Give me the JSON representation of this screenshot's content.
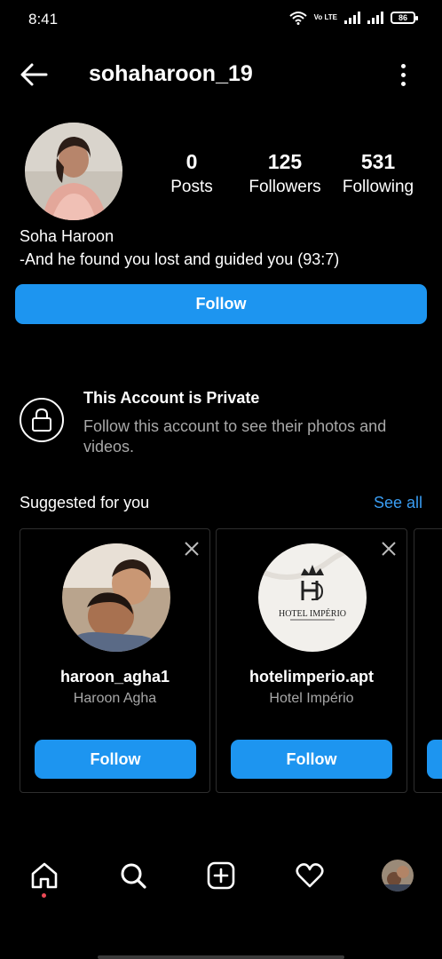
{
  "status_bar": {
    "time": "8:41",
    "volte": "Vo LTE",
    "battery": "86"
  },
  "header": {
    "username": "sohaharoon_19"
  },
  "profile": {
    "stats": [
      {
        "value": "0",
        "label": "Posts"
      },
      {
        "value": "125",
        "label": "Followers"
      },
      {
        "value": "531",
        "label": "Following"
      }
    ],
    "full_name": "Soha Haroon",
    "bio": "-And he found you lost and guided you (93:7)",
    "follow_label": "Follow"
  },
  "private_notice": {
    "title": "This Account is Private",
    "description": "Follow this account to see their photos and videos."
  },
  "suggestions": {
    "title": "Suggested for you",
    "see_all": "See all",
    "items": [
      {
        "username": "haroon_agha1",
        "full_name": "Haroon Agha",
        "follow_label": "Follow"
      },
      {
        "username": "hotelimperio.apt",
        "full_name": "Hotel Império",
        "follow_label": "Follow",
        "logo_text": "HOTEL IMPÉRIO"
      }
    ]
  },
  "bottom_nav": {
    "items": [
      "home-icon",
      "search-icon",
      "add-post-icon",
      "activity-heart-icon",
      "profile-avatar"
    ]
  },
  "colors": {
    "accent": "#1d95f0",
    "link": "#3a9df2",
    "secondary_text": "#a8a8a8",
    "notification_dot": "#ed4956"
  }
}
